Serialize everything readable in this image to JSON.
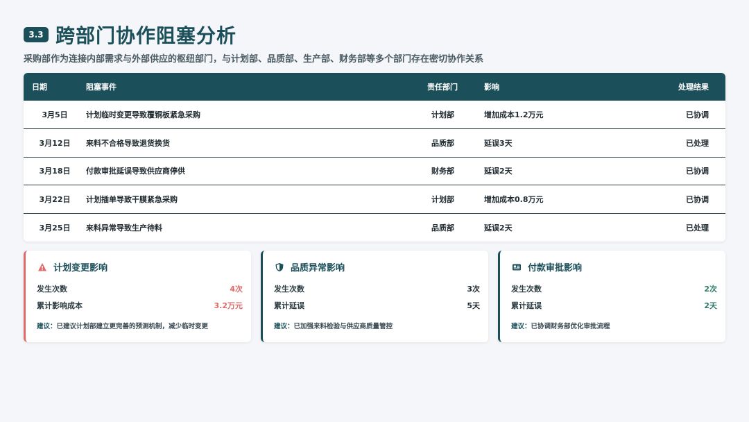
{
  "header": {
    "badge": "3.3",
    "title": "跨部门协作阻塞分析",
    "subtitle": "采购部作为连接内部需求与外部供应的枢纽部门，与计划部、品质部、生产部、财务部等多个部门存在密切协作关系"
  },
  "table": {
    "headers": {
      "date": "日期",
      "event": "阻塞事件",
      "dept": "责任部门",
      "impact": "影响",
      "result": "处理结果"
    },
    "rows": [
      {
        "date": "3月5日",
        "event": "计划临时变更导致覆铜板紧急采购",
        "dept": "计划部",
        "impact": "增加成本1.2万元",
        "result": "已协调"
      },
      {
        "date": "3月12日",
        "event": "来料不合格导致退货换货",
        "dept": "品质部",
        "impact": "延误3天",
        "result": "已处理"
      },
      {
        "date": "3月18日",
        "event": "付款审批延误导致供应商停供",
        "dept": "财务部",
        "impact": "延误2天",
        "result": "已协调"
      },
      {
        "date": "3月22日",
        "event": "计划插单导致干膜紧急采购",
        "dept": "计划部",
        "impact": "增加成本0.8万元",
        "result": "已协调"
      },
      {
        "date": "3月25日",
        "event": "来料异常导致生产待料",
        "dept": "品质部",
        "impact": "延误2天",
        "result": "已处理"
      }
    ]
  },
  "cards": [
    {
      "icon": "warning-icon",
      "title": "计划变更影响",
      "stat1_label": "发生次数",
      "stat1_value": "4次",
      "stat2_label": "累计影响成本",
      "stat2_value": "3.2万元",
      "advice_label": "建议：",
      "advice": "已建议计划部建立更完善的预测机制，减少临时变更",
      "accent": "#e06a6a"
    },
    {
      "icon": "shield-icon",
      "title": "品质异常影响",
      "stat1_label": "发生次数",
      "stat1_value": "3次",
      "stat2_label": "累计延误",
      "stat2_value": "5天",
      "advice_label": "建议：",
      "advice": "已加强来料检验与供应商质量管控",
      "accent": "#1b4f5a"
    },
    {
      "icon": "id-card-icon",
      "title": "付款审批影响",
      "stat1_label": "发生次数",
      "stat1_value": "2次",
      "stat2_label": "累计延误",
      "stat2_value": "2天",
      "advice_label": "建议：",
      "advice": "已协调财务部优化审批流程",
      "accent": "#1b4f5a"
    }
  ]
}
